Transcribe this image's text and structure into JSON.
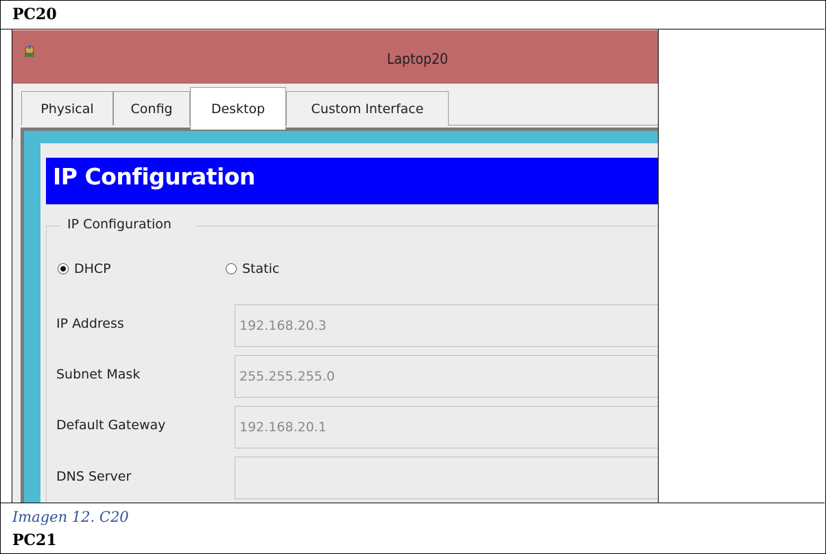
{
  "document": {
    "section_top": "PC20",
    "caption": "Imagen 12. C20",
    "section_bottom": "PC21"
  },
  "window": {
    "title": "Laptop20",
    "icon": "packet-tracer-laptop-icon"
  },
  "tabs": [
    {
      "label": "Physical",
      "active": false
    },
    {
      "label": "Config",
      "active": false
    },
    {
      "label": "Desktop",
      "active": true
    },
    {
      "label": "Custom Interface",
      "active": false
    }
  ],
  "ip_config": {
    "banner_title": "IP Configuration",
    "group_label": "IP Configuration",
    "mode_options": [
      {
        "label": "DHCP",
        "selected": true
      },
      {
        "label": "Static",
        "selected": false
      }
    ],
    "fields": [
      {
        "label": "IP Address",
        "value": "192.168.20.3"
      },
      {
        "label": "Subnet Mask",
        "value": "255.255.255.0"
      },
      {
        "label": "Default Gateway",
        "value": "192.168.20.1"
      },
      {
        "label": "DNS Server",
        "value": ""
      }
    ]
  },
  "colors": {
    "titlebar": "#c0696a",
    "banner": "#0000ff",
    "content_accent": "#4dbbd5",
    "caption": "#2f5597"
  }
}
